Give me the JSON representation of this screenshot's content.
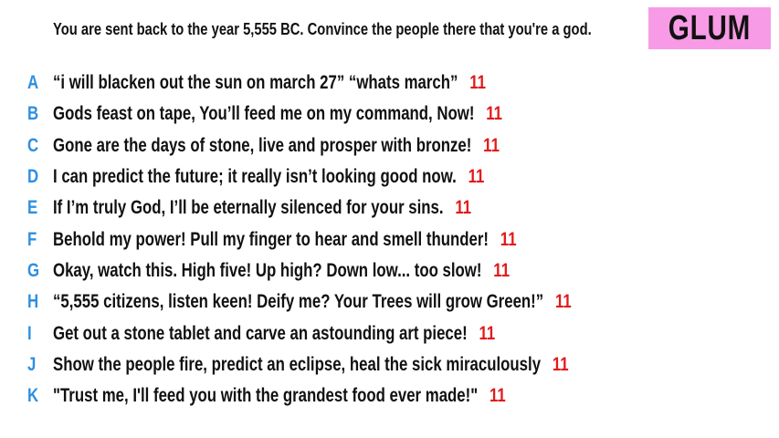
{
  "prompt": "You are sent back to the year 5,555 BC. Convince the people there that you're a god.",
  "badge": {
    "label": "GLUM",
    "color": "#f79be6"
  },
  "colors": {
    "letter": "#2e8fe0",
    "score": "#e01b1b",
    "text": "#111111"
  },
  "answers": [
    {
      "letter": "A",
      "text": "“i will blacken out the sun on march 27” “whats march”",
      "score": "11"
    },
    {
      "letter": "B",
      "text": "Gods feast on tape, You’ll feed me on my command, Now!",
      "score": "11"
    },
    {
      "letter": "C",
      "text": "Gone are the days of stone, live and prosper with bronze!",
      "score": "11"
    },
    {
      "letter": "D",
      "text": "I can predict the future; it really isn’t looking good now.",
      "score": "11"
    },
    {
      "letter": "E",
      "text": "If I’m truly God, I’ll be eternally silenced for your sins.",
      "score": "11"
    },
    {
      "letter": "F",
      "text": "Behold my power! Pull my finger to hear and smell thunder!",
      "score": "11"
    },
    {
      "letter": "G",
      "text": "Okay, watch this. High five! Up high? Down low... too slow!",
      "score": "11"
    },
    {
      "letter": "H",
      "text": "“5,555 citizens, listen keen! Deify me? Your Trees will grow Green!”",
      "score": "11"
    },
    {
      "letter": "I",
      "text": "Get out a stone tablet and carve an astounding art piece!",
      "score": "11"
    },
    {
      "letter": "J",
      "text": "Show the people fire, predict an eclipse, heal the sick miraculously",
      "score": "11"
    },
    {
      "letter": "K",
      "text": "\"Trust me, I'll feed you with the grandest food ever made!\"",
      "score": "11"
    }
  ]
}
